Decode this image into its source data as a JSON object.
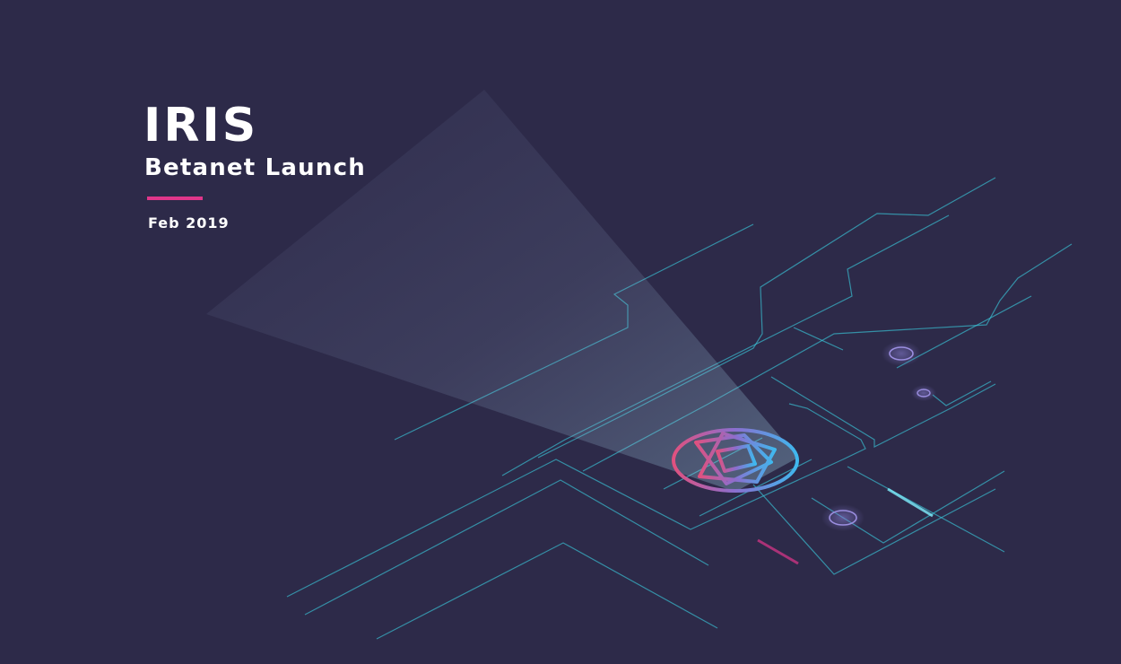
{
  "banner": {
    "title": "IRIS",
    "subtitle": "Betanet Launch",
    "date": "Feb 2019"
  },
  "colors": {
    "background": "#2d2a49",
    "accent_pink": "#e0368b",
    "circuit_cyan": "#3ac6d8",
    "text": "#ffffff"
  },
  "icons": {
    "logo": "iris-network-logo-icon"
  }
}
